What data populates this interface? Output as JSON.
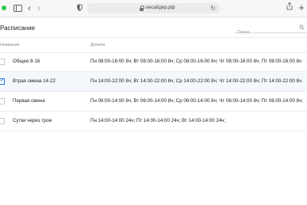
{
  "browser": {
    "url": "инсайдер.рф"
  },
  "page": {
    "title": "Расписание",
    "search_placeholder": "Поиск"
  },
  "table": {
    "headers": {
      "name": "Название",
      "details": "Детали"
    },
    "rows": [
      {
        "name": "Общее 8-16",
        "details": "Пн 08:00-16:00 8ч; Вт 08:00-16:00 8ч; Ср 08:00-16:00 8ч; Чт 08:00-16:00 8ч; Пт 08:00-16:00 8ч",
        "checked": false
      },
      {
        "name": "Втрая смена 14-22",
        "details": "Пн 14:00-22:00 8ч; Вт 14:00-22:00 8ч; Ср 14:00-22:00 8ч; Чт 14:00-22:00 8ч; Пт 14:00-22:00 8ч",
        "checked": true
      },
      {
        "name": "Первая смена",
        "details": "Пн 06:00-14:00 8ч; Вт 06:00-14:00 8ч; Ср 06:00-14:00 8ч; Чт 06:00-14:00 8ч; Пт 06:00-14:00 8ч;",
        "checked": false
      },
      {
        "name": "Сутки через трое",
        "details": "Пн 14:00-14:00 24ч; Пт 14:00-14:00 24ч;  Вт 14:00-14:00 24ч;",
        "checked": false
      }
    ]
  },
  "colors": {
    "accent": "#1a73e8",
    "selected_row": "#f4f8fd"
  }
}
